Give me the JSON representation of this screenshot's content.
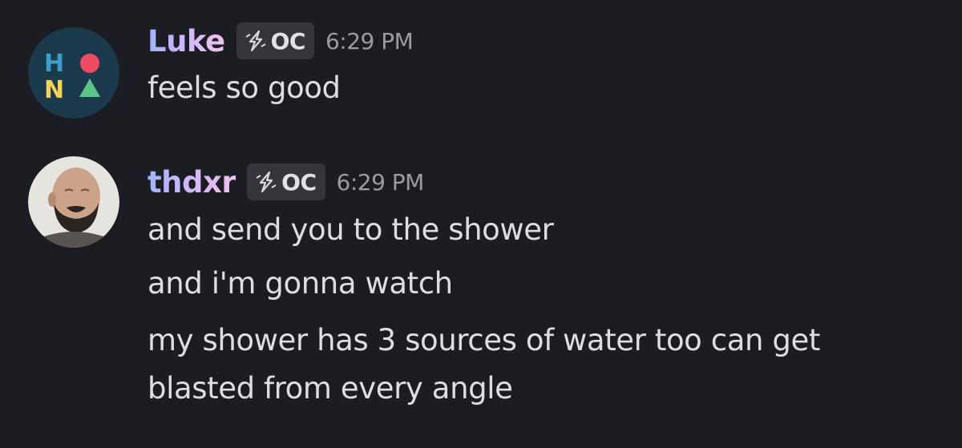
{
  "messages": [
    {
      "username": "Luke",
      "tag": "OC",
      "tag_icon": "lightning-bolt-icon",
      "timestamp": "6:29 PM",
      "avatar": "hona-logo-avatar",
      "avatar_text": {
        "h": "H",
        "n": "N"
      },
      "lines": [
        "feels so good"
      ]
    },
    {
      "username": "thdxr",
      "tag": "OC",
      "tag_icon": "lightning-bolt-icon",
      "timestamp": "6:29 PM",
      "avatar": "bearded-man-avatar",
      "lines": [
        "and send you to the shower",
        "and i'm gonna watch",
        "my shower has 3 sources of water too can get",
        "blasted from every angle"
      ]
    }
  ],
  "colors": {
    "background": "#1c1d22",
    "message_text": "#dddee2",
    "timestamp": "#9a9ca3",
    "tag_bg": "#34363c",
    "hona_navy": "#1b3a4b",
    "hona_blue": "#3aa0c8",
    "hona_red": "#ef4b63",
    "hona_yellow": "#f5d15c",
    "hona_green": "#58c48a"
  }
}
